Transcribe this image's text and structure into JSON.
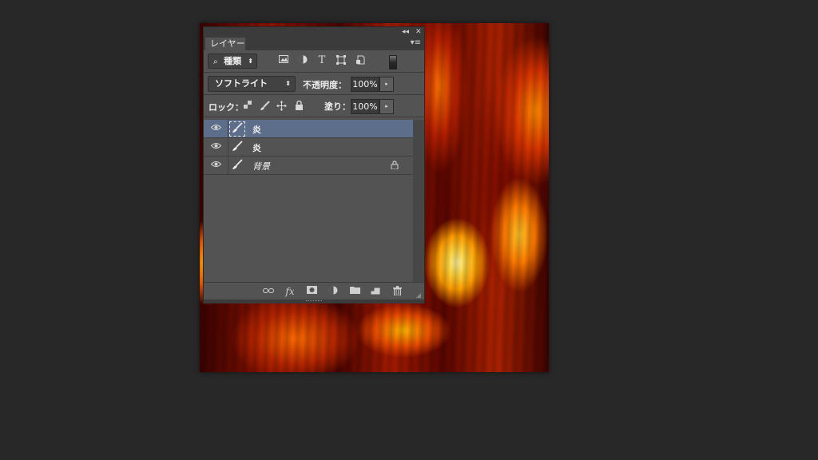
{
  "panel": {
    "collapse_icon": "◂◂",
    "close_icon": "✕",
    "tab_label": "レイヤー",
    "menu_icon": "▾≡"
  },
  "filter": {
    "search_icon": "⌕",
    "kind_label": "種類",
    "arrows": "⬍"
  },
  "blend": {
    "mode": "ソフトライト",
    "opacity_label": "不透明度：",
    "opacity_value": "100%",
    "arrow": "▸"
  },
  "lockrow": {
    "lock_label": "ロック：",
    "fill_label": "塗り：",
    "fill_value": "100%"
  },
  "layers": [
    {
      "name": "炎",
      "selected": true
    },
    {
      "name": "炎",
      "selected": false
    },
    {
      "name": "背景",
      "selected": false,
      "locked": true
    }
  ],
  "icons": {
    "eye": "◉",
    "brush": "⟋",
    "lock": "🔒"
  },
  "colors": {
    "panel_bg": "#535353",
    "selection": "#5d6e8a",
    "app_bg": "#282828"
  }
}
